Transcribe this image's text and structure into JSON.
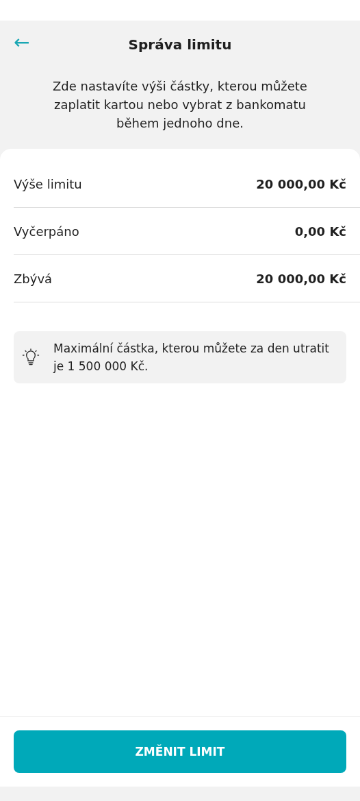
{
  "header": {
    "back": "←",
    "title": "Správa limitu"
  },
  "description": "Zde nastavíte výši částky, kterou můžete zaplatit kartou nebo vybrat z bankomatu během jednoho dne.",
  "rows": [
    {
      "label": "Výše limitu",
      "value": "20 000,00 Kč"
    },
    {
      "label": "Vyčerpáno",
      "value": "0,00 Kč"
    },
    {
      "label": "Zbývá",
      "value": "20 000,00 Kč"
    }
  ],
  "tip": "Maximální částka, kterou můžete za den utratit je 1 500 000 Kč.",
  "button": "ZMĚNIT LIMIT"
}
